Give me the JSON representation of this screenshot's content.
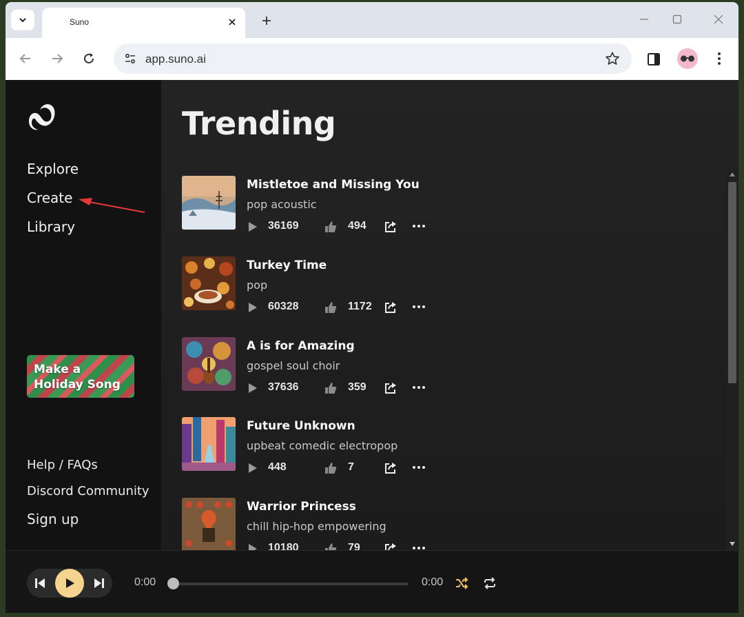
{
  "browser": {
    "tab_title": "Suno",
    "url": "app.suno.ai",
    "icons": [
      "tab-search-icon",
      "close-icon",
      "plus-icon",
      "minimize-icon",
      "maximize-icon",
      "close-window-icon",
      "back-icon",
      "forward-icon",
      "reload-icon",
      "site-info-icon",
      "star-icon",
      "side-panel-icon",
      "profile-avatar",
      "kebab-icon"
    ]
  },
  "sidebar": {
    "nav": [
      {
        "label": "Explore"
      },
      {
        "label": "Create"
      },
      {
        "label": "Library"
      }
    ],
    "promo_label": "Make a Holiday Song",
    "footer": [
      {
        "label": "Help / FAQs"
      },
      {
        "label": "Discord Community"
      },
      {
        "label": "Sign up"
      }
    ]
  },
  "main": {
    "heading": "Trending",
    "songs": [
      {
        "title": "Mistletoe and Missing You",
        "genre": "pop acoustic",
        "plays": "36169",
        "likes": "494"
      },
      {
        "title": "Turkey Time",
        "genre": "pop",
        "plays": "60328",
        "likes": "1172"
      },
      {
        "title": "A is for Amazing",
        "genre": "gospel soul choir",
        "plays": "37636",
        "likes": "359"
      },
      {
        "title": "Future Unknown",
        "genre": "upbeat comedic electropop",
        "plays": "448",
        "likes": "7"
      },
      {
        "title": "Warrior Princess",
        "genre": "chill hip-hop empowering",
        "plays": "10180",
        "likes": "79"
      }
    ]
  },
  "player": {
    "current_time": "0:00",
    "total_time": "0:00",
    "progress": 0
  },
  "colors": {
    "accent": "#f5d58e",
    "annotation_arrow": "#e53935",
    "background": "#1a1a1a"
  }
}
